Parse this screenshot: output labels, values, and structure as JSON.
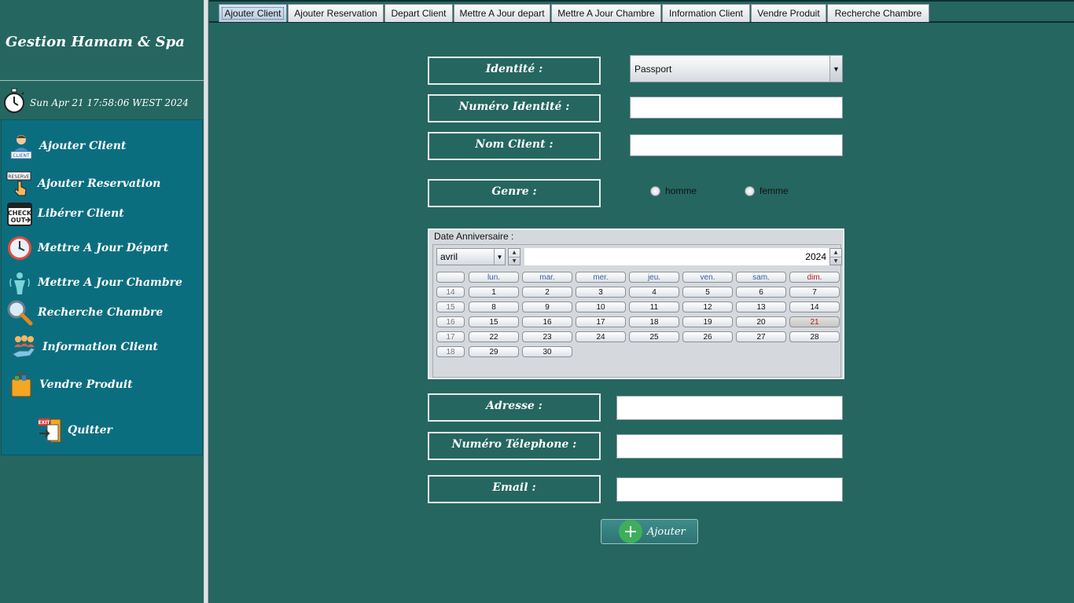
{
  "app": {
    "title": "Gestion Hamam & Spa",
    "clock": "Sun Apr 21 17:58:06 WEST 2024"
  },
  "menu": [
    {
      "label": "Ajouter Client",
      "icon": "client-icon"
    },
    {
      "label": "Ajouter Reservation",
      "icon": "reserve-icon"
    },
    {
      "label": "Libérer Client",
      "icon": "check-out-icon"
    },
    {
      "label": "Mettre A Jour Départ",
      "icon": "clock-icon"
    },
    {
      "label": "Mettre A Jour Chambre",
      "icon": "person-icon"
    },
    {
      "label": "Recherche Chambre",
      "icon": "search-icon"
    },
    {
      "label": "Information Client",
      "icon": "group-icon"
    },
    {
      "label": "Vendre Produit",
      "icon": "shopping-bag-icon"
    },
    {
      "label": "Quitter",
      "icon": "exit-icon"
    }
  ],
  "tabs": [
    "Ajouter Client",
    "Ajouter Reservation",
    "Depart Client",
    "Mettre A Jour depart",
    "Mettre A Jour Chambre",
    "Information Client",
    "Vendre Produit",
    "Recherche Chambre"
  ],
  "form": {
    "identite_label": "Identité :",
    "identite_value": "Passport",
    "numero_identite_label": "Numéro Identité :",
    "numero_identite_value": "",
    "nom_client_label": "Nom Client :",
    "nom_client_value": "",
    "genre_label": "Genre :",
    "genre_options": [
      "homme",
      "femme"
    ],
    "adresse_label": "Adresse :",
    "adresse_value": "",
    "telephone_label": "Numéro Télephone :",
    "telephone_value": "",
    "email_label": "Email :",
    "email_value": "",
    "submit_label": "Ajouter"
  },
  "calendar": {
    "title": "Date Anniversaire :",
    "month": "avril",
    "year": "2024",
    "weekday_headers": [
      "lun.",
      "mar.",
      "mer.",
      "jeu.",
      "ven.",
      "sam.",
      "dim."
    ],
    "week_numbers": [
      "14",
      "15",
      "16",
      "17",
      "18"
    ],
    "weeks": [
      [
        "1",
        "2",
        "3",
        "4",
        "5",
        "6",
        "7"
      ],
      [
        "8",
        "9",
        "10",
        "11",
        "12",
        "13",
        "14"
      ],
      [
        "15",
        "16",
        "17",
        "18",
        "19",
        "20",
        "21"
      ],
      [
        "22",
        "23",
        "24",
        "25",
        "26",
        "27",
        "28"
      ],
      [
        "29",
        "30"
      ]
    ],
    "selected_day": "21",
    "colors": {
      "weekday_header": "#3b5fa0",
      "sunday": "#b0201d"
    }
  },
  "colors": {
    "background": "#256660",
    "menu_panel": "#0b6e7f",
    "add_button_plus": "#3fae5b"
  }
}
